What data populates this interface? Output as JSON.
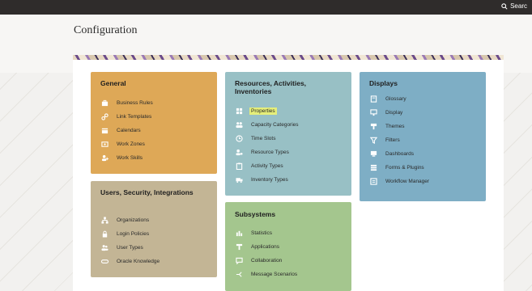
{
  "header": {
    "search_label": "Searc"
  },
  "page": {
    "title": "Configuration"
  },
  "cards": {
    "general": {
      "title": "General",
      "items": [
        "Business Rules",
        "Link Templates",
        "Calendars",
        "Work Zones",
        "Work Skills"
      ],
      "icons": [
        "briefcase-icon",
        "link-icon",
        "calendar-icon",
        "map-icon",
        "person-skill-icon"
      ]
    },
    "users": {
      "title": "Users, Security, Integrations",
      "items": [
        "Organizations",
        "Login Policies",
        "User Types",
        "Oracle Knowledge"
      ],
      "icons": [
        "org-chart-icon",
        "lock-icon",
        "users-icon",
        "toggle-icon"
      ]
    },
    "resources": {
      "title": "Resources, Activities, Inventories",
      "items": [
        "Properties",
        "Capacity Categories",
        "Time Slots",
        "Resource Types",
        "Activity Types",
        "Inventory Types"
      ],
      "icons": [
        "grid-icon",
        "people-icon",
        "clock-icon",
        "person-gear-icon",
        "clipboard-icon",
        "truck-icon"
      ],
      "highlighted_item": "Properties"
    },
    "subsystems": {
      "title": "Subsystems",
      "items": [
        "Statistics",
        "Applications",
        "Collaboration",
        "Message Scenarios"
      ],
      "icons": [
        "bar-chart-icon",
        "plug-icon",
        "chat-icon",
        "message-flow-icon"
      ]
    },
    "displays": {
      "title": "Displays",
      "items": [
        "Glossary",
        "Display",
        "Themes",
        "Filters",
        "Dashboards",
        "Forms & Plugins",
        "Workflow Manager"
      ],
      "icons": [
        "book-icon",
        "monitor-icon",
        "brush-icon",
        "filter-icon",
        "dashboard-icon",
        "form-icon",
        "workflow-icon"
      ]
    }
  }
}
